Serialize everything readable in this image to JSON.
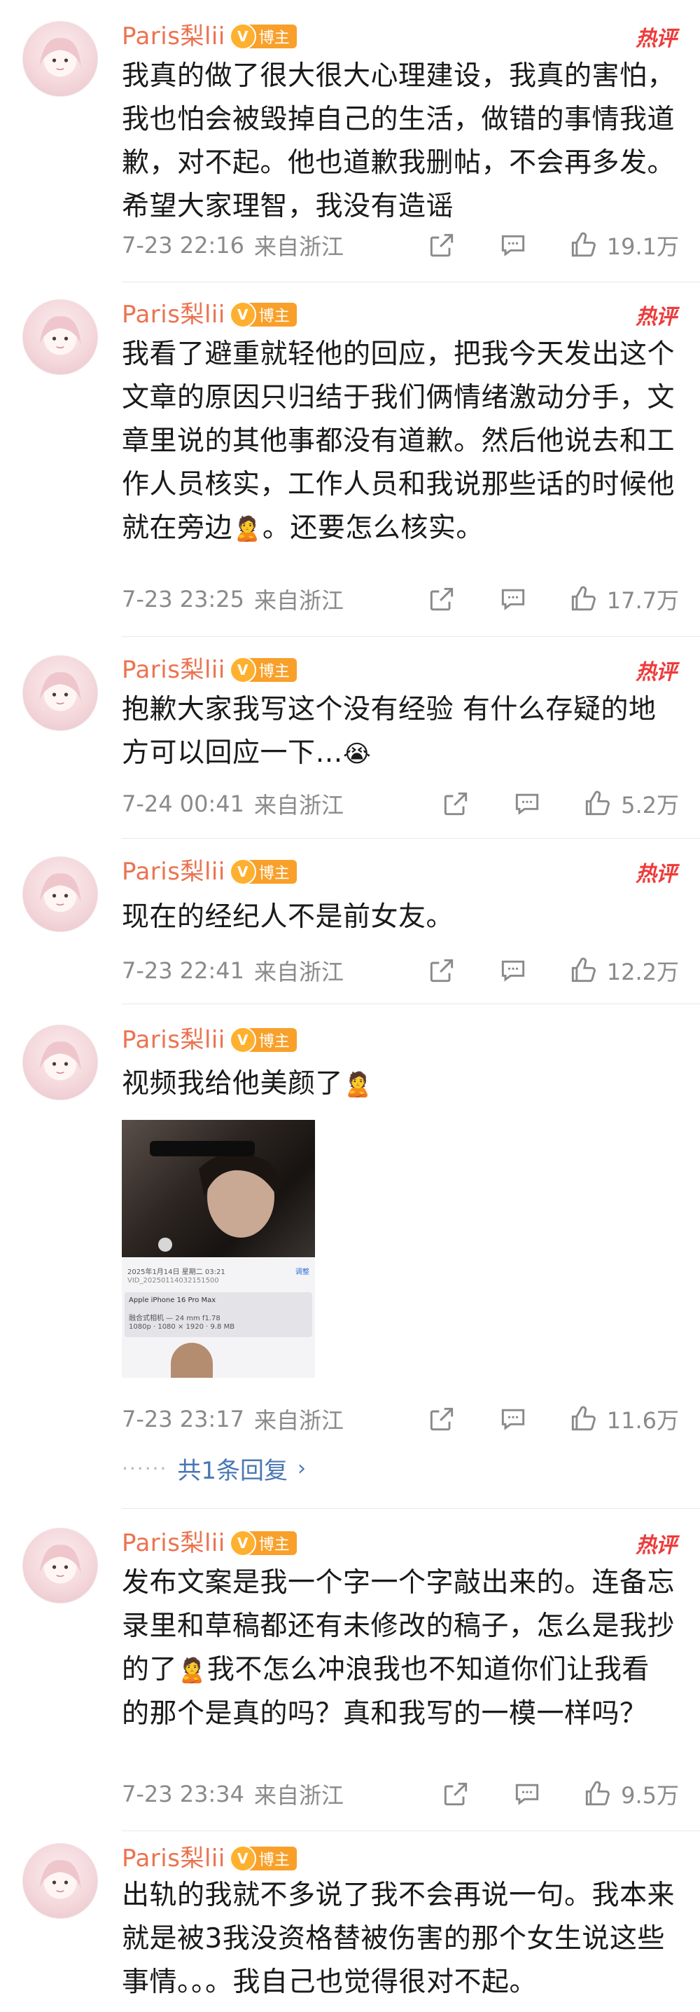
{
  "user": {
    "name": "Paris梨lii",
    "badge": "博主",
    "badge_icon": "V"
  },
  "hot_label": "热评",
  "comments": [
    {
      "text": "我真的做了很大很大心理建设，我真的害怕，我也怕会被毁掉自己的生活，做错的事情我道歉，对不起。他也道歉我删帖，不会再多发。希望大家理智，我没有造谣",
      "time": "7-23 22:16",
      "location": "来自浙江",
      "likes": "19.1万"
    },
    {
      "text_before": "我看了避重就轻他的回应，把我今天发出这个文章的原因只归结于我们俩情绪激动分手，文章里说的其他事都没有道歉。然后他说去和工作人员核实，工作人员和我说那些话的时候他就在旁边",
      "emoji": "🙎",
      "text_after": "。还要怎么核实。",
      "time": "7-23 23:25",
      "location": "来自浙江",
      "likes": "17.7万"
    },
    {
      "text_before": "抱歉大家我写这个没有经验 有什么存疑的地方可以回应一下…",
      "emoji": "😭",
      "time": "7-24 00:41",
      "location": "来自浙江",
      "likes": "5.2万"
    },
    {
      "text": "现在的经纪人不是前女友。",
      "time": "7-23 22:41",
      "location": "来自浙江",
      "likes": "12.2万"
    },
    {
      "text_before": "视频我给他美颜了",
      "emoji": "🙎",
      "media": {
        "date_line": "2025年1月14日 星期二 03:21",
        "file_name": "VID_20250114032151500",
        "device": "Apple iPhone 16 Pro Max",
        "camera": "融合式相机 — 24 mm f1.78",
        "specs": "1080p · 1080 × 1920 · 9.8 MB",
        "adjust": "调整"
      },
      "time": "7-23 23:17",
      "location": "来自浙江",
      "likes": "11.6万",
      "reply_link": "共1条回复"
    },
    {
      "text_before": "发布文案是我一个字一个字敲出来的。连备忘录里和草稿都还有未修改的稿子，怎么是我抄的了",
      "emoji": "🙎",
      "text_after": "我不怎么冲浪我也不知道你们让我看的那个是真的吗？真和我写的一模一样吗？",
      "time": "7-23 23:34",
      "location": "来自浙江",
      "likes": "9.5万"
    },
    {
      "text": "出轨的我就不多说了我不会再说一句。我本来就是被3我没资格替被伤害的那个女生说这些事情。。。我自己也觉得很对不起。"
    }
  ]
}
